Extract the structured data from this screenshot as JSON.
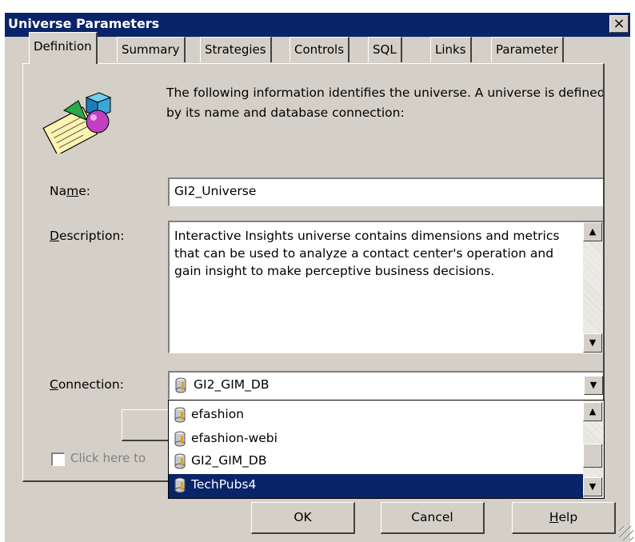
{
  "window": {
    "title": "Universe Parameters",
    "close_label": "×"
  },
  "tabs": [
    {
      "label": "Definition"
    },
    {
      "label": "Summary"
    },
    {
      "label": "Strategies"
    },
    {
      "label": "Controls"
    },
    {
      "label": "SQL"
    },
    {
      "label": "Links"
    },
    {
      "label": "Parameter"
    }
  ],
  "definition": {
    "intro": "The following information identifies the universe. A universe is defined by its name and database connection:",
    "name_label_pre": "Na",
    "name_label_u": "m",
    "name_label_post": "e:",
    "name_value": "GI2_Universe",
    "description_label_u": "D",
    "description_label_post": "escription:",
    "description_value": "Interactive Insights universe contains dimensions and metrics that can be used to analyze a contact center's operation and gain insight to make perceptive business decisions.",
    "connection_label_u": "C",
    "connection_label_post": "onnection:",
    "connection_value": "GI2_GIM_DB",
    "connection_options": [
      "efashion",
      "efashion-webi",
      "GI2_GIM_DB",
      "TechPubs4"
    ],
    "selected_option": "TechPubs4",
    "checkbox_label": "Click here to"
  },
  "buttons": {
    "ok": "OK",
    "cancel": "Cancel",
    "help_u": "H",
    "help_post": "elp"
  },
  "icons": {
    "universe": "universe-shapes-icon",
    "database": "database-cylinder-icon"
  }
}
